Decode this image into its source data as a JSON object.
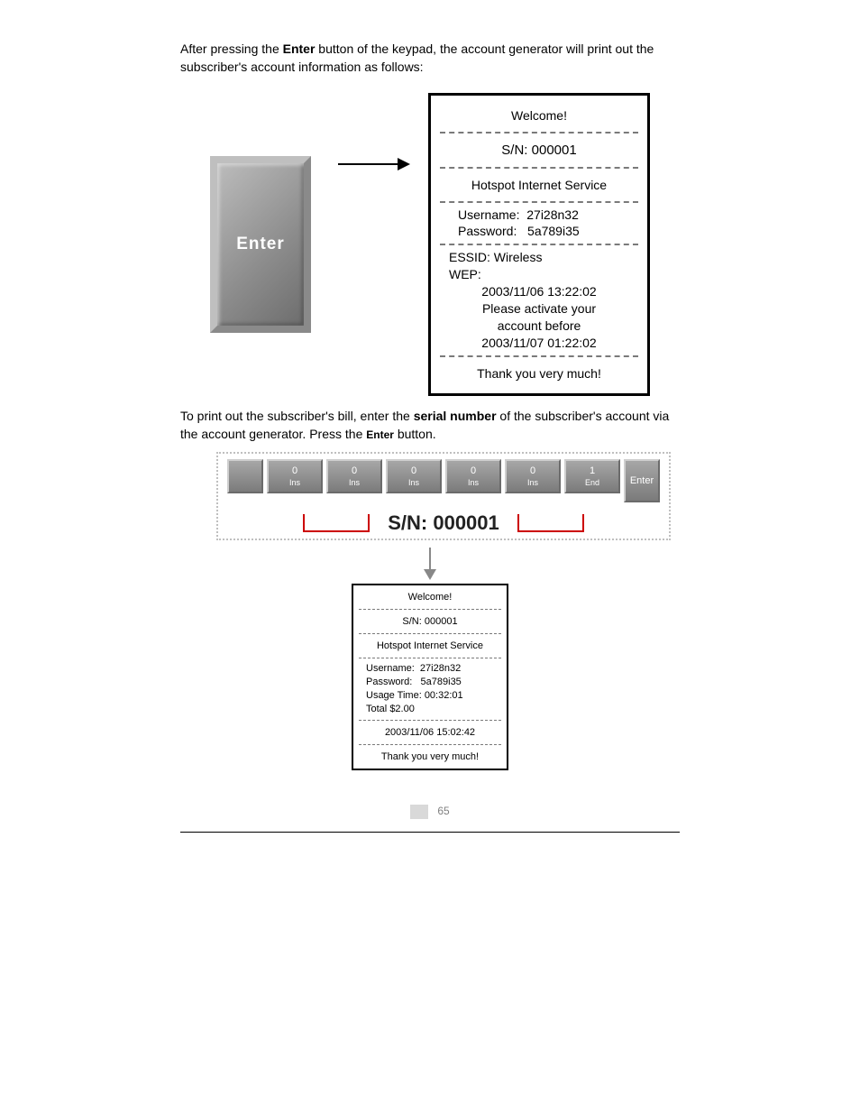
{
  "intro1_pre": "After pressing the ",
  "intro1_key": "Enter",
  "intro1_post": " button of the keypad, the account generator will print out the subscriber's account information as follows:",
  "fig1": {
    "enter_button": "Enter",
    "ticket": {
      "welcome": "Welcome!",
      "sn_label": "S/N:",
      "sn_value": "000001",
      "service": "Hotspot Internet Service",
      "username_label": "Username:",
      "username_value": "27i28n32",
      "password_label": "Password:",
      "password_value": "5a789i35",
      "essid_label": "ESSID:",
      "essid_value": "Wireless",
      "wep_label": "WEP:",
      "timestamp": "2003/11/06 13:22:02",
      "activate_l1": "Please activate your",
      "activate_l2": "account before",
      "activate_deadline": "2003/11/07 01:22:02",
      "thanks": "Thank you very much!"
    }
  },
  "intro2_pre": "To print out the subscriber's bill, enter the ",
  "intro2_key": "serial number",
  "intro2_post": " of the subscriber's account via the account generator. Press the ",
  "intro2_key2": "Enter",
  "intro2_tail": " button.",
  "keypad": {
    "keys": [
      {
        "top": " ",
        "bot": " "
      },
      {
        "top": "0",
        "bot": "Ins"
      },
      {
        "top": "0",
        "bot": "Ins"
      },
      {
        "top": "0",
        "bot": "Ins"
      },
      {
        "top": "0",
        "bot": "Ins"
      },
      {
        "top": "0",
        "bot": "Ins"
      },
      {
        "top": "1",
        "bot": "End"
      },
      {
        "top": "Enter",
        "bot": ""
      }
    ],
    "sn_big_label": "S/N:",
    "sn_big_value": "000001"
  },
  "fig2": {
    "ticket": {
      "welcome": "Welcome!",
      "sn_label": "S/N:",
      "sn_value": "000001",
      "service": "Hotspot Internet Service",
      "username_label": "Username:",
      "username_value": "27i28n32",
      "password_label": "Password:",
      "password_value": "5a789i35",
      "usage_label": "Usage Time:",
      "usage_value": "00:32:01",
      "total_label": "Total",
      "total_value": "$2.00",
      "timestamp": "2003/11/06 15:02:42",
      "thanks": "Thank you very much!"
    }
  },
  "page_number": "65"
}
